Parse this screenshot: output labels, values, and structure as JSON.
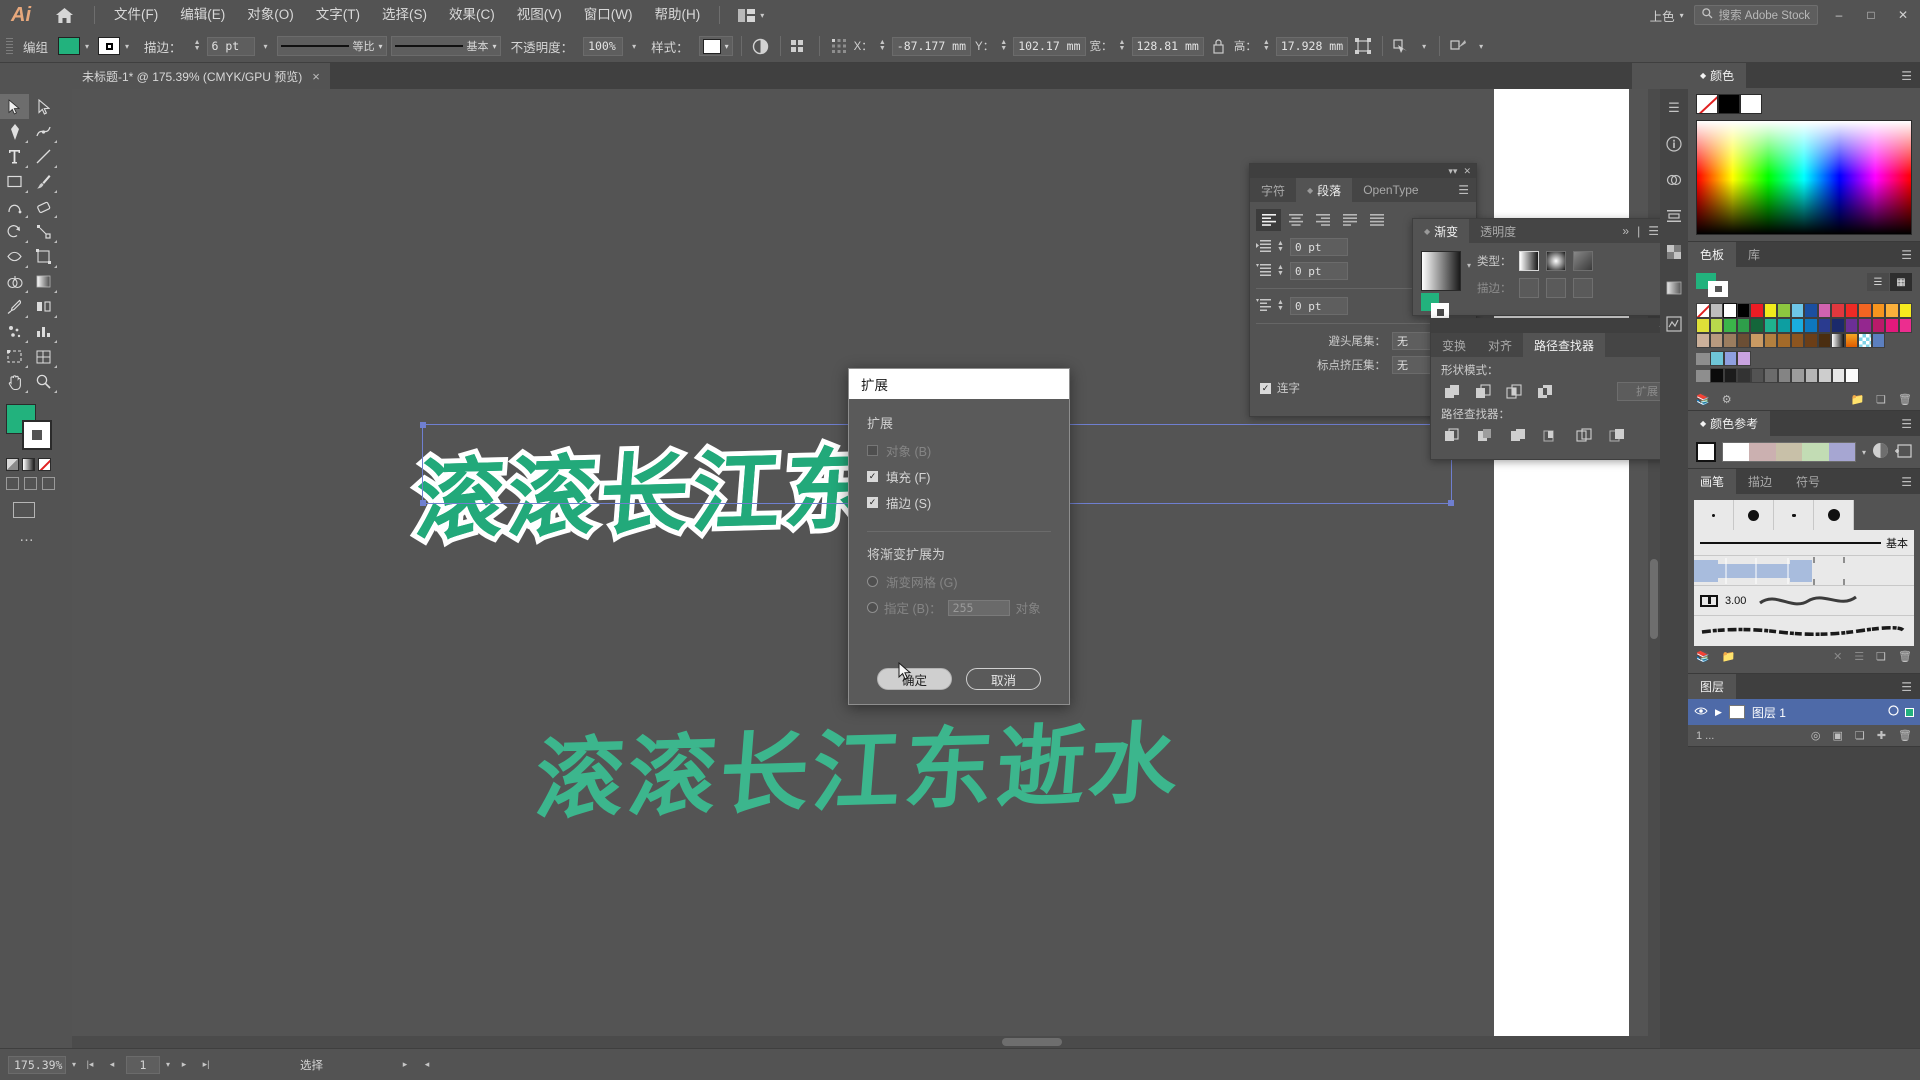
{
  "app": {
    "name": "Ai",
    "home_icon": "home-icon"
  },
  "menubar": {
    "items": [
      "文件(F)",
      "编辑(E)",
      "对象(O)",
      "文字(T)",
      "选择(S)",
      "效果(C)",
      "视图(V)",
      "窗口(W)",
      "帮助(H)"
    ],
    "arrange_icon": "arrange-documents-icon",
    "right": {
      "workspace": "上色",
      "search_placeholder": "搜索 Adobe Stock",
      "search_icon": "search-icon",
      "minimize": "–",
      "maximize": "□",
      "close": "✕"
    }
  },
  "controlbar": {
    "object_label": "编组",
    "fill_color": "#22b27d",
    "stroke_color": "#ffffff",
    "stroke_label": "描边：",
    "stroke_weight": "6 pt",
    "stroke_profile": "等比",
    "brush_def": "基本",
    "opacity_label": "不透明度：",
    "opacity_value": "100%",
    "style_label": "样式：",
    "x_label": "X：",
    "x_value": "-87.177 mm",
    "y_label": "Y：",
    "y_value": "102.17 mm",
    "w_label": "宽：",
    "w_value": "128.81 mm",
    "h_label": "高：",
    "h_value": "17.928 mm"
  },
  "document_tab": {
    "title": "未标题-1* @ 175.39% (CMYK/GPU 预览)",
    "close_icon": "close-icon"
  },
  "toolbar": {
    "tools": [
      "selection-tool",
      "direct-selection-tool",
      "pen-tool",
      "curvature-tool",
      "type-tool",
      "line-tool",
      "rectangle-tool",
      "paintbrush-tool",
      "shaper-tool",
      "eraser-tool",
      "rotate-tool",
      "scale-tool",
      "width-tool",
      "free-transform-tool",
      "shape-builder-tool",
      "gradient-tool",
      "eyedropper-tool",
      "blend-tool",
      "symbol-sprayer-tool",
      "column-graph-tool",
      "artboard-tool",
      "slice-tool",
      "hand-tool",
      "zoom-tool"
    ],
    "fill_color": "#22b27d",
    "stroke_color": "#ffffff",
    "more_tools": "…"
  },
  "canvas": {
    "artwork_text_outlined": "滚滚长江东逝水",
    "artwork_text_solid": "滚滚长江东逝水",
    "artwork_fill": "#3cb68d",
    "artwork_stroke": "#ffffff",
    "selection_color": "#6f7fd0"
  },
  "dialog": {
    "title": "扩展",
    "group1_title": "扩展",
    "checkbox_object": "对象 (B)",
    "checkbox_object_checked": false,
    "checkbox_object_enabled": false,
    "checkbox_fill": "填充 (F)",
    "checkbox_fill_checked": true,
    "checkbox_stroke": "描边 (S)",
    "checkbox_stroke_checked": true,
    "group2_title": "将渐变扩展为",
    "radio_mesh": "渐变网格 (G)",
    "radio_specify": "指定 (B)：",
    "specify_value": "255",
    "specify_suffix": "对象",
    "ok_label": "确定",
    "cancel_label": "取消"
  },
  "paragraph_panel": {
    "tabs": [
      "字符",
      "段落",
      "OpenType"
    ],
    "active_tab": "段落",
    "align_icons": [
      "align-left-icon",
      "align-center-icon",
      "align-right-icon",
      "justify-last-left-icon",
      "justify-all-icon"
    ],
    "indent_left": "0 pt",
    "indent_right": "0 pt",
    "space_before": "0 pt",
    "burasagari_label": "避头尾集：",
    "burasagari_value": "无",
    "kinsoku_label": "标点挤压集：",
    "kinsoku_value": "无",
    "ligature_label": "连字",
    "ligature_checked": true
  },
  "gradient_panel": {
    "tabs": [
      "渐变",
      "透明度"
    ],
    "active_tab": "渐变",
    "type_label": "类型：",
    "stroke_label": "描边：",
    "collapse_icon": "double-chevron-icon",
    "menu_icon": "panel-menu-icon"
  },
  "pathfinder_panel": {
    "tabs": [
      "变换",
      "对齐",
      "路径查找器"
    ],
    "active_tab": "路径查找器",
    "shape_modes_label": "形状模式：",
    "expand_label": "扩展",
    "pathfinders_label": "路径查找器：",
    "menu_icon": "panel-menu-icon"
  },
  "dock": {
    "color": {
      "tab": "颜色",
      "none_swatch": "none-swatch",
      "black_swatch": "#000000",
      "white_swatch": "#ffffff",
      "menu_icon": "panel-menu-icon"
    },
    "swatches": {
      "tabs": [
        "色板",
        "库"
      ],
      "active_tab": "色板",
      "fill_color": "#22b27d",
      "list_view_icon": "list-view-icon",
      "grid_view_icon": "grid-view-icon",
      "colors_row1": [
        "#ffffff",
        "#000000",
        "#ed1c24",
        "#f0eb1c",
        "#8dc63f",
        "#6ec6e8",
        "#1b4fa0",
        "#d163b0",
        "#e0383e",
        "#ee2a25",
        "#f26522",
        "#f7941e",
        "#fbb03b"
      ],
      "colors_row2": [
        "#f5ea1e",
        "#dfe038",
        "#b9d94c",
        "#3bb54a",
        "#2e9e4a",
        "#14663a",
        "#1fb28e",
        "#0d9ea1",
        "#1aace0",
        "#0d77bf",
        "#2a3b8f",
        "#1b2a6b",
        "#6c2f96",
        "#94278f",
        "#b91a6a"
      ],
      "colors_row3": [
        "#e2197c",
        "#ec2d8f",
        "#cbb09a",
        "#b89a7f",
        "#9b7d5f",
        "#6b4e34",
        "#c99a63",
        "#b3803f",
        "#a36a29",
        "#8c5520",
        "#6b3e17",
        "#4a2d10",
        "#gradwhite",
        "#f5a623",
        "#checker"
      ],
      "footer_icons": [
        "swatch-libraries-icon",
        "show-list-icon",
        "new-color-group-icon",
        "new-swatch-icon",
        "delete-swatch-icon"
      ]
    },
    "color_guide": {
      "tab": "颜色参考",
      "harmony_icon": "harmony-rules-icon",
      "edit_icon": "edit-colors-icon",
      "menu_icon": "panel-menu-icon"
    },
    "brushes": {
      "tabs": [
        "画笔",
        "描边",
        "符号"
      ],
      "active_tab": "画笔",
      "basic_label": "基本",
      "value_3": "3.00",
      "footer_icons": [
        "brush-libraries-icon",
        "libraries-icon",
        "remove-brush-stroke-icon",
        "options-icon",
        "new-brush-icon",
        "delete-brush-icon"
      ]
    },
    "layers": {
      "tab": "图层",
      "layer_name": "图层 1",
      "visible_icon": "eye-icon",
      "expand_icon": "chevron-right-icon",
      "target_icon": "target-icon",
      "count": "1 ..."
    }
  },
  "statusbar": {
    "zoom": "175.39%",
    "artboard_nav_first": "first-artboard-icon",
    "artboard_nav_prev": "prev-artboard-icon",
    "artboard_number": "1",
    "artboard_nav_next": "next-artboard-icon",
    "artboard_nav_last": "last-artboard-icon",
    "status_text": "选择",
    "play_icon": "play-icon",
    "prev_icon": "prev-icon"
  },
  "rail": {
    "icons": [
      "panel-menu-icon",
      "info-icon",
      "appearance-icon",
      "align-icon",
      "transparency-icon",
      "gradient-rail-icon",
      "image-trace-icon"
    ]
  }
}
